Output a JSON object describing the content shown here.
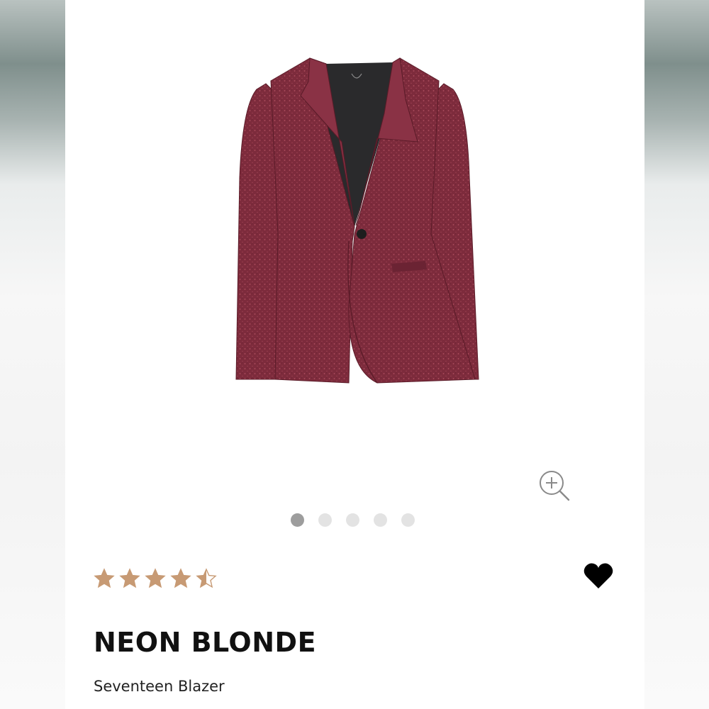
{
  "product": {
    "brand": "NEON BLONDE",
    "name": "Seventeen Blazer",
    "image_subject": "burgundy sparkle blazer",
    "rating": 4.5,
    "rating_max": 5,
    "favorited": true
  },
  "carousel": {
    "total_images": 5,
    "active_index": 0
  },
  "icons": {
    "zoom": "zoom-in-icon",
    "favorite": "heart-icon",
    "star": "star-icon"
  },
  "colors": {
    "star": "#c79a74",
    "heart": "#000000",
    "dot_active": "#9d9d9d",
    "dot_inactive": "#e3e3e3",
    "blazer": "#7a2a3a"
  }
}
